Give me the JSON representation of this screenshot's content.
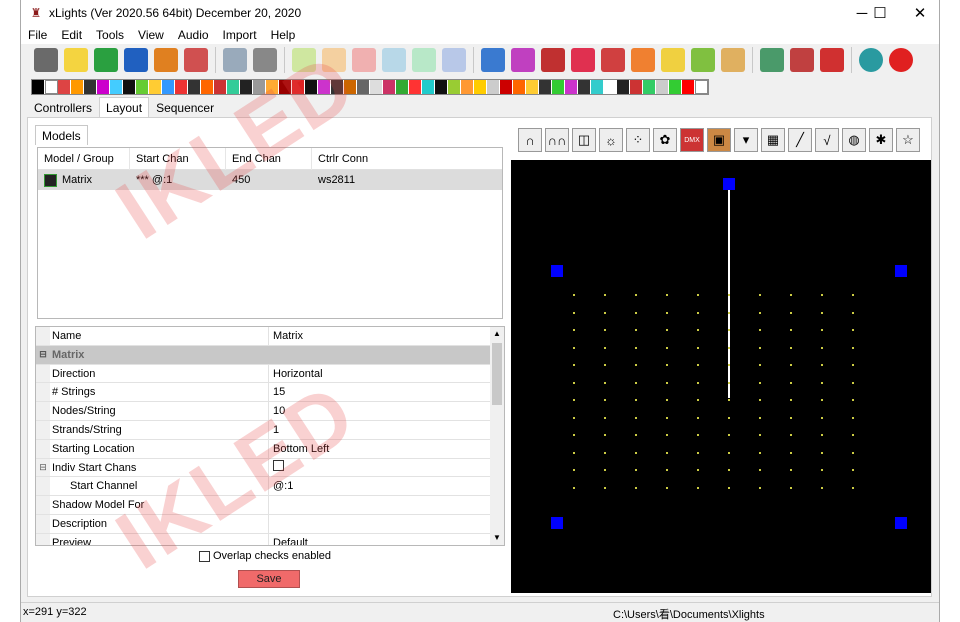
{
  "window": {
    "title": "xLights (Ver 2020.56 64bit) December 20, 2020",
    "minimize": "─",
    "maximize": "☐",
    "close": "✕"
  },
  "menu": [
    "File",
    "Edit",
    "Tools",
    "View",
    "Audio",
    "Import",
    "Help"
  ],
  "tabs": [
    "Controllers",
    "Layout",
    "Sequencer"
  ],
  "subtab": "Models",
  "models_table": {
    "headers": [
      "Model / Group",
      "Start Chan",
      "End Chan",
      "Ctrlr Conn"
    ],
    "rows": [
      {
        "name": "Matrix",
        "start": "*** @:1",
        "end": "450",
        "conn": "ws2811"
      }
    ]
  },
  "properties": {
    "header": {
      "name": "Name",
      "value": "Matrix"
    },
    "category": "Matrix",
    "rows": [
      {
        "name": "Direction",
        "value": "Horizontal"
      },
      {
        "name": "# Strings",
        "value": "15"
      },
      {
        "name": "Nodes/String",
        "value": "10"
      },
      {
        "name": "Strands/String",
        "value": "1"
      },
      {
        "name": "Starting Location",
        "value": "Bottom Left"
      },
      {
        "name": "Indiv Start Chans",
        "value": ""
      },
      {
        "name": "Start Channel",
        "value": "@:1"
      },
      {
        "name": "Shadow Model For",
        "value": ""
      },
      {
        "name": "Description",
        "value": ""
      },
      {
        "name": "Preview",
        "value": "Default"
      }
    ]
  },
  "overlap_label": "Overlap checks enabled",
  "save_label": "Save",
  "status": {
    "coords": "x=291 y=322",
    "path": "C:\\Users\\看\\Documents\\Xlights"
  },
  "watermark": [
    "IKLED",
    "IKLED"
  ]
}
